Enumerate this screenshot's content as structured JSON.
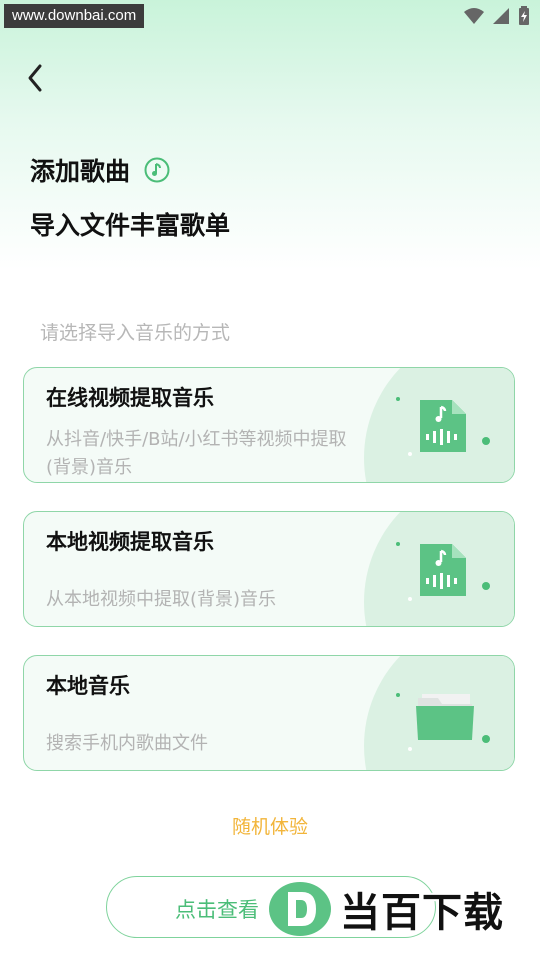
{
  "status_bar": {
    "watermark": "www.downbai.com",
    "icons": [
      "wifi-icon",
      "signal-icon",
      "battery-icon"
    ]
  },
  "header": {
    "title": "添加歌曲",
    "subtitle": "导入文件丰富歌单"
  },
  "hint": "请选择导入音乐的方式",
  "cards": [
    {
      "title": "在线视频提取音乐",
      "desc": "从抖音/快手/B站/小红书等视频中提取(背景)音乐",
      "icon": "music-file-icon"
    },
    {
      "title": "本地视频提取音乐",
      "desc": "从本地视频中提取(背景)音乐",
      "icon": "music-file-icon"
    },
    {
      "title": "本地音乐",
      "desc": "搜索手机内歌曲文件",
      "icon": "folder-icon"
    }
  ],
  "random_label": "随机体验",
  "view_button_label": "点击查看",
  "brand_watermark": "当百下载",
  "colors": {
    "accent": "#4bbd78",
    "orange": "#f2b53a",
    "card_border": "#8fd6a8"
  }
}
